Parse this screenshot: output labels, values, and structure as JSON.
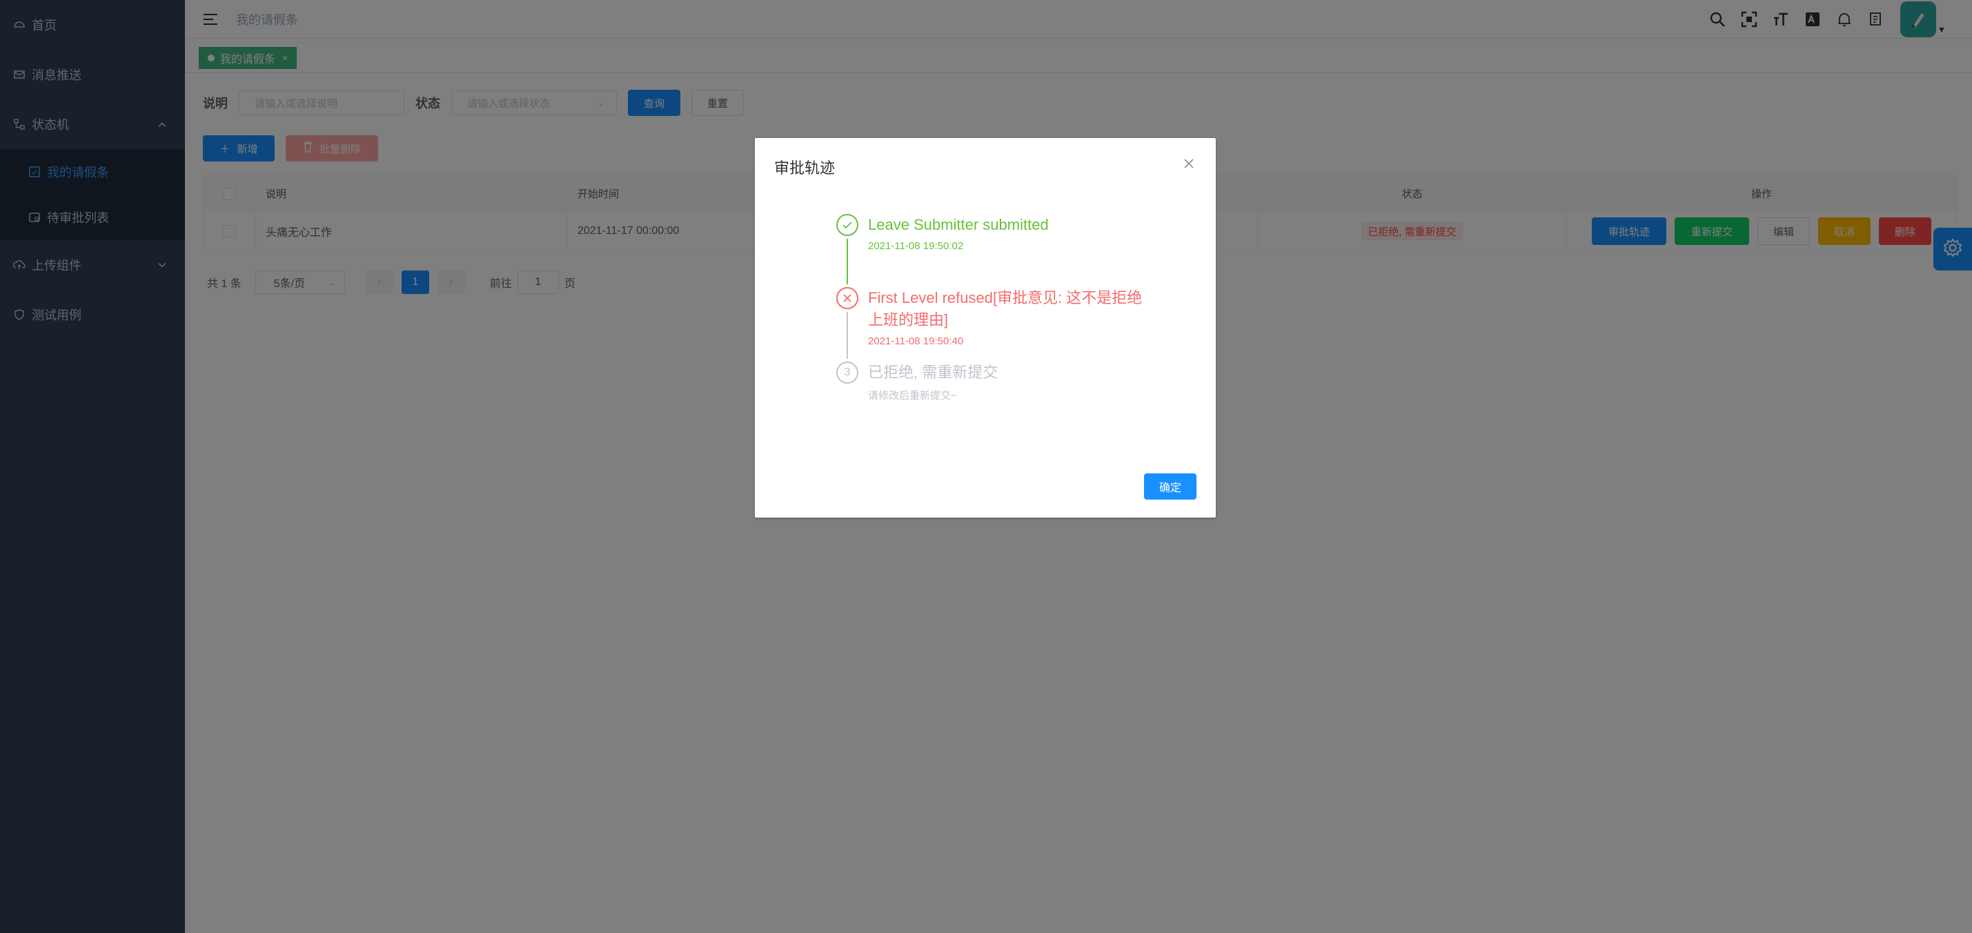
{
  "sidebar": {
    "items": [
      {
        "label": "首页",
        "icon": "dashboard-icon"
      },
      {
        "label": "消息推送",
        "icon": "message-icon"
      },
      {
        "label": "状态机",
        "icon": "tree-icon"
      },
      {
        "label": "上传组件",
        "icon": "cloud-upload-icon"
      },
      {
        "label": "测试用例",
        "icon": "shield-icon"
      }
    ],
    "submenu": [
      {
        "label": "我的请假条",
        "icon": "form-icon"
      },
      {
        "label": "待审批列表",
        "icon": "list-icon"
      }
    ]
  },
  "header": {
    "breadcrumb": "我的请假条"
  },
  "tags": {
    "active": "我的请假条",
    "close": "×"
  },
  "filters": {
    "desc_label": "说明",
    "desc_placeholder": "请输入或选择说明",
    "status_label": "状态",
    "status_placeholder": "请输入或选择状态",
    "query": "查询",
    "reset": "重置"
  },
  "actions": {
    "add": "新增",
    "batch_delete": "批量删除"
  },
  "table": {
    "columns": [
      "说明",
      "开始时间",
      "状态",
      "操作"
    ],
    "rows": [
      {
        "desc": "头痛无心工作",
        "start": "2021-11-17 00:00:00",
        "status": "已拒绝, 需重新提交",
        "ops": [
          "审批轨迹",
          "重新提交",
          "编辑",
          "取消",
          "删除"
        ]
      }
    ]
  },
  "pager": {
    "total": "共 1 条",
    "page_size": "5条/页",
    "current": "1",
    "goto_label": "前往",
    "goto_value": "1",
    "page_unit": "页"
  },
  "dialog": {
    "title": "审批轨迹",
    "close": "×",
    "steps": [
      {
        "title": "Leave Submitter submitted",
        "desc": "2021-11-08 19:50:02",
        "status": "success",
        "icon": "check-icon"
      },
      {
        "title": "First Level refused[审批意见: 这不是拒绝上班的理由]",
        "desc": "2021-11-08 19:50:40",
        "status": "error",
        "icon": "close-icon"
      },
      {
        "title": "已拒绝, 需重新提交",
        "desc": "请修改后重新提交~",
        "status": "wait",
        "number": "3"
      }
    ],
    "ok": "确定"
  },
  "colors": {
    "primary": "#1890ff",
    "success": "#67c23a",
    "danger": "#f56c6c",
    "sidebar": "#304156"
  }
}
